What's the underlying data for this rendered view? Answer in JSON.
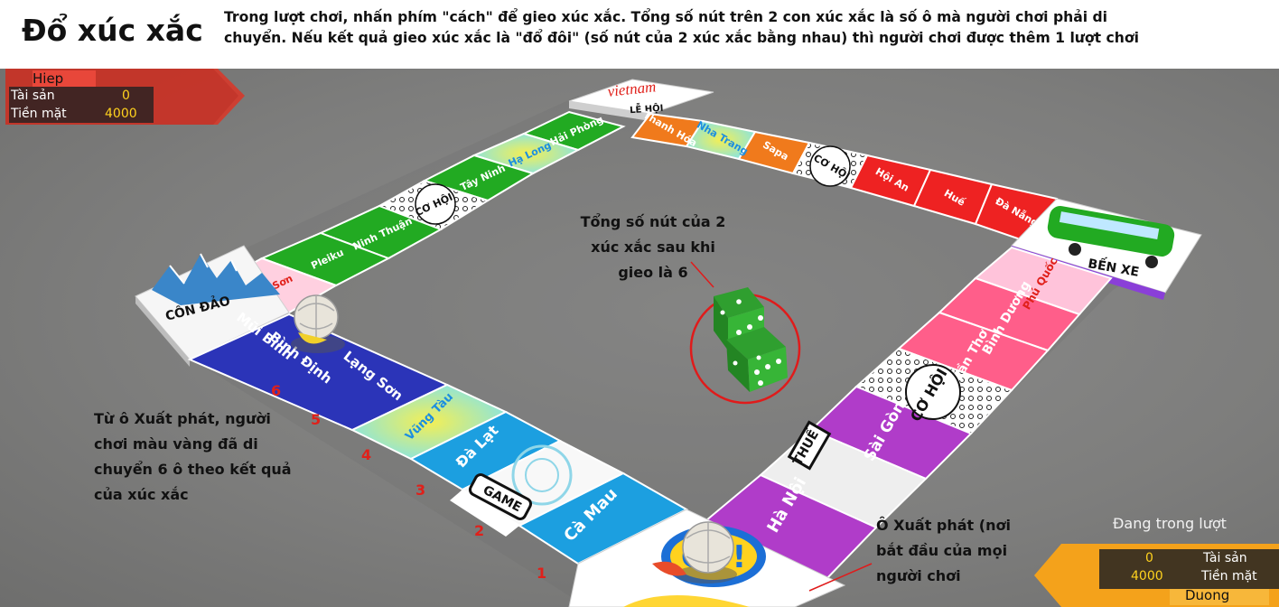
{
  "header": {
    "title": "Đổ xúc xắc",
    "instruction_line1": "Trong lượt chơi, nhấn phím \"cách\" để gieo xúc xắc. Tổng số nút trên 2 con xúc xắc là số ô mà người chơi phải di",
    "instruction_line2": "chuyển. Nếu kết quả gieo xúc xắc là \"đổ đôi\" (số nút của 2 xúc xắc bằng nhau) thì người chơi được thêm 1 lượt chơi"
  },
  "player_top": {
    "name": "Hiep",
    "assets_label": "Tài sản",
    "assets_value": "0",
    "cash_label": "Tiền mặt",
    "cash_value": "4000"
  },
  "player_bottom": {
    "name": "Duong",
    "assets_label": "Tài sản",
    "assets_value": "0",
    "cash_label": "Tiền mặt",
    "cash_value": "4000",
    "status": "Đang trong lượt"
  },
  "board": {
    "corners": {
      "top": "LỄ HỘI",
      "top_logo": "vietnam",
      "right": "BẾN XE",
      "left": "CÔN ĐẢO",
      "go": "GO!"
    },
    "top_left_row": [
      "Hải Phòng",
      "Hạ Long",
      "Tây Ninh",
      "CƠ HỘI",
      "Ninh Thuận",
      "Pleiku",
      "Đồ Sơn"
    ],
    "top_right_row": [
      "Thanh Hóa",
      "Nha Trang",
      "Sapa",
      "CƠ HỘI",
      "Hội An",
      "Huế",
      "Đà Nẵng"
    ],
    "right_row": [
      "Phú Quốc",
      "Bình Dương",
      "Cần Thơ",
      "CƠ HỘI",
      "Sài Gòn",
      "THUẾ",
      "Hà Nội"
    ],
    "left_row": [
      "Cà Mau",
      "GAME",
      "",
      "Đà Lạt",
      "Vũng Tàu",
      "Lạng Sơn",
      "Bình Định",
      "Mũi Bình"
    ]
  },
  "annotations": {
    "dice": "Tổng số nút của 2\nxúc xắc sau khi\ngieo là 6",
    "moved": "Từ ô Xuất phát, người\nchơi màu vàng đã di\nchuyển 6 ô theo kết quả\ncủa xúc xắc",
    "start": "Ô Xuất phát (nơi\nbắt đầu của mọi\nngười chơi"
  },
  "step_numbers": [
    "1",
    "2",
    "3",
    "4",
    "5",
    "6"
  ],
  "dice": {
    "total": 6
  },
  "colors": {
    "red": "#ee2222",
    "green": "#22aa22",
    "orange": "#f07a1c",
    "pink": "#ff5e8a",
    "purple": "#b03cc9",
    "blue": "#1c9fe0",
    "navy": "#2b34b8",
    "hud_red": "#d6382a",
    "hud_orange": "#f4a21b"
  }
}
